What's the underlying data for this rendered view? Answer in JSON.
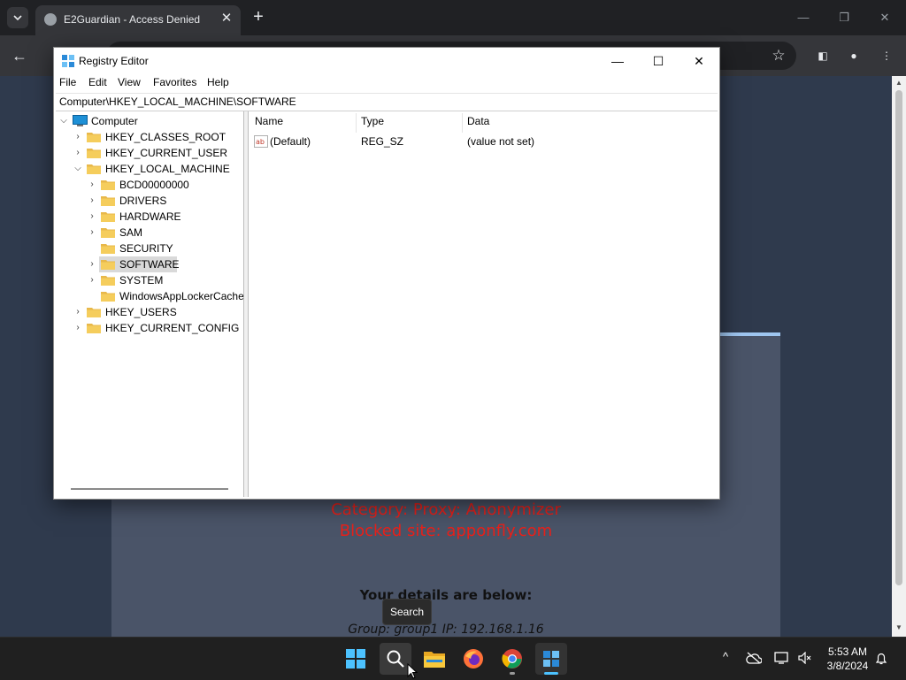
{
  "browser": {
    "tab_title": "E2Guardian - Access Denied",
    "tab_close": "✕",
    "new_tab": "+",
    "window_controls": {
      "minimize": "—",
      "restore": "❐",
      "close": "✕"
    },
    "toolbar": {
      "back": "←",
      "star": "☆",
      "side_panel": "◧",
      "profile": "●",
      "menu": "⋮"
    }
  },
  "page": {
    "blocked_category": "Category: Proxy: Anonymizer",
    "blocked_site": "Blocked site: apponfly.com",
    "details_title": "Your details are below:",
    "details_line": "Group: group1   IP: 192.168.1.16"
  },
  "regedit": {
    "title": "Registry Editor",
    "controls": {
      "minimize": "—",
      "maximize": "☐",
      "close": "✕"
    },
    "menu": [
      "File",
      "Edit",
      "View",
      "Favorites",
      "Help"
    ],
    "address": "Computer\\HKEY_LOCAL_MACHINE\\SOFTWARE",
    "tree": {
      "root": "Computer",
      "hives": {
        "classes_root": "HKEY_CLASSES_ROOT",
        "current_user": "HKEY_CURRENT_USER",
        "local_machine": "HKEY_LOCAL_MACHINE",
        "users": "HKEY_USERS",
        "current_config": "HKEY_CURRENT_CONFIG"
      },
      "hklm_children": {
        "bcd": "BCD00000000",
        "drivers": "DRIVERS",
        "hardware": "HARDWARE",
        "sam": "SAM",
        "security": "SECURITY",
        "software": "SOFTWARE",
        "system": "SYSTEM",
        "applocker": "WindowsAppLockerCache"
      },
      "selected": "SOFTWARE"
    },
    "list": {
      "columns": {
        "name": "Name",
        "type": "Type",
        "data": "Data"
      },
      "values": [
        {
          "name": "(Default)",
          "type": "REG_SZ",
          "data": "(value not set)",
          "icon": "string-value-icon"
        }
      ]
    }
  },
  "taskbar": {
    "search_tooltip": "Search",
    "apps": [
      "start-icon",
      "search-icon",
      "file-explorer-icon",
      "firefox-icon",
      "chrome-icon",
      "registry-editor-icon"
    ],
    "tray": {
      "chevron": "^"
    },
    "clock": {
      "time": "5:53 AM",
      "date": "3/8/2024"
    }
  },
  "colors": {
    "accent": "#0078d4",
    "blocked_text": "#e8201a",
    "folder": "#e8b84a"
  }
}
